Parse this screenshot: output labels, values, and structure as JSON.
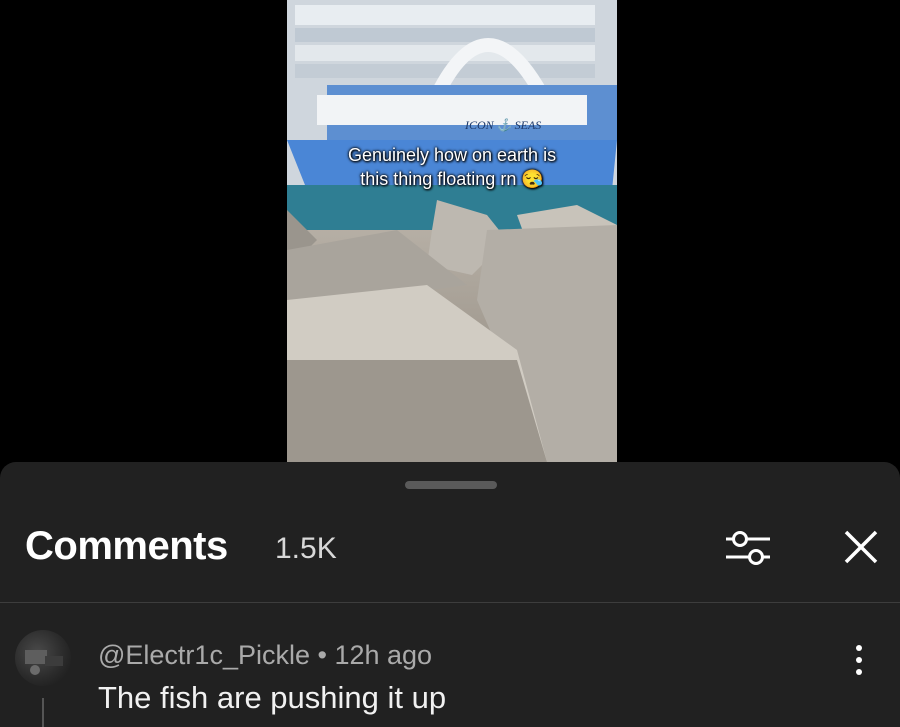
{
  "video": {
    "caption_line1": "Genuinely how on earth is",
    "caption_line2": "this thing floating rn 😪",
    "ship_name": "ICON ⚓ SEAS"
  },
  "comments_panel": {
    "title": "Comments",
    "count": "1.5K",
    "filter_icon": "sliders-icon",
    "close_icon": "close-icon"
  },
  "comments": [
    {
      "author": "@Electr1c_Pickle",
      "time": "12h ago",
      "separator": "•",
      "text": "The fish are pushing it up",
      "more_icon": "more-vertical-icon"
    }
  ],
  "colors": {
    "sheet_background": "#212121",
    "meta_text": "#aaaaaa",
    "primary_text": "#f1f1f1"
  }
}
